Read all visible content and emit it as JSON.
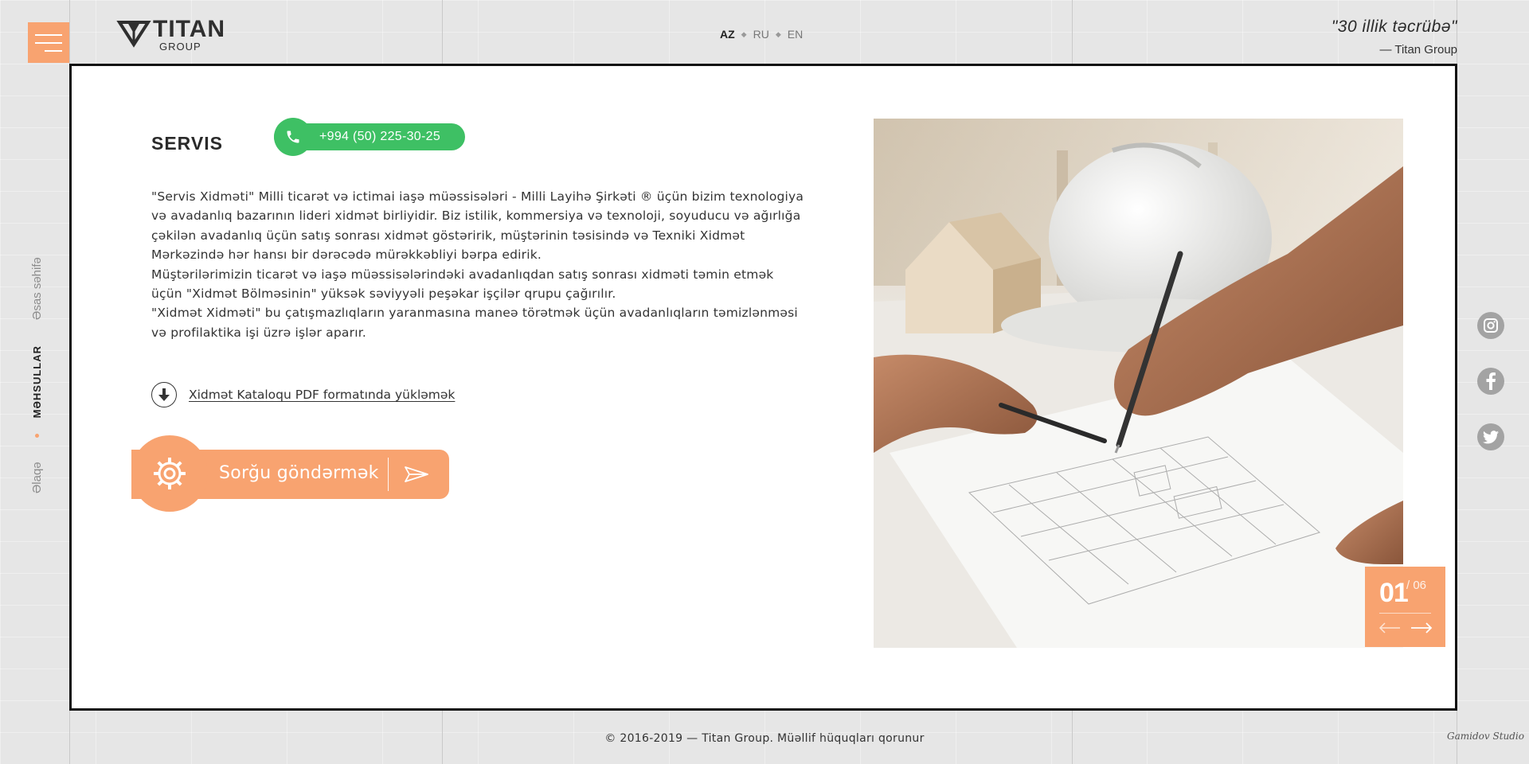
{
  "header": {
    "logo": {
      "name": "TITAN",
      "sub": "GROUP"
    },
    "languages": [
      {
        "code": "AZ",
        "active": true
      },
      {
        "code": "RU",
        "active": false
      },
      {
        "code": "EN",
        "active": false
      }
    ],
    "quote": {
      "text": "\"30 illik təcrübə\"",
      "author": "— Titan Group"
    }
  },
  "side_nav": {
    "items": [
      {
        "label": "Əsas səhifə",
        "active": false
      },
      {
        "label": "Məhsullar",
        "active": true
      },
      {
        "label": "Əlaqə",
        "active": false
      }
    ]
  },
  "main": {
    "title": "SERVIS",
    "phone": "+994 (50) 225-30-25",
    "paragraphs": [
      "\"Servis Xidməti\" Milli ticarət və ictimai iaşə müəssisələri - Milli Layihə Şirkəti ® üçün bizim texnologiya və avadanlıq bazarının lideri xidmət birliyidir. Biz istilik, kommersiya və texnoloji, soyuducu və ağırlığa çəkilən avadanlıq üçün satış sonrası xidmət göstəririk, müştərinin təsisində və Texniki Xidmət Mərkəzində hər hansı bir dərəcədə mürəkkəbliyi bərpa edirik.",
      "Müştərilərimizin ticarət və iaşə müəssisələrindəki avadanlıqdan satış sonrası xidməti təmin etmək üçün \"Xidmət Bölməsinin\" yüksək səviyyəli peşəkar işçilər qrupu çağırılır.",
      "\"Xidmət Xidməti\" bu çatışmazlıqların yaranmasına maneə törətmək üçün avadanlıqların təmizlənməsi və profilaktika işi üzrə işlər aparır."
    ],
    "download_label": "Xidmət Kataloqu PDF formatında yükləmək",
    "request_label": "Sorğu göndərmək"
  },
  "slider": {
    "current": "01",
    "total": "/ 06"
  },
  "social": [
    "instagram-icon",
    "facebook-icon",
    "twitter-icon"
  ],
  "footer": {
    "copyright": "© 2016-2019 — Titan Group. Müəllif hüquqları qorunur",
    "credit": "Gamidov Studio"
  },
  "colors": {
    "accent": "#f8a370",
    "phone_green": "#3ec064",
    "social_gray": "#a3a3a3"
  }
}
